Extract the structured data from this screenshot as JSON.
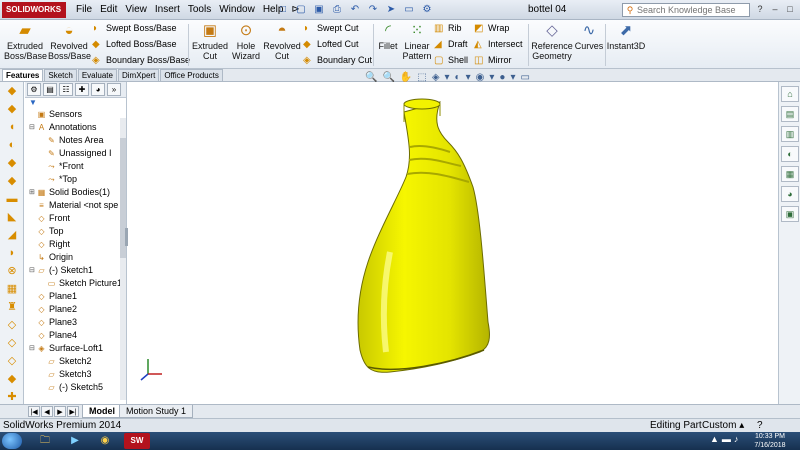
{
  "app": {
    "logo_text": "SOLIDWORKS",
    "doc_title": "bottel 04",
    "menu": [
      "File",
      "Edit",
      "View",
      "Insert",
      "Tools",
      "Window",
      "Help"
    ],
    "menu_pin": "⊳",
    "quick_tools": [
      "□",
      "▢",
      "▣",
      "⎙",
      "↶",
      "↷",
      "➤",
      "▭",
      "⚙"
    ],
    "window_controls": [
      "?",
      "–",
      "□",
      "✕"
    ]
  },
  "search": {
    "placeholder": "Search Knowledge Base"
  },
  "ribbon": {
    "extruded_boss": "Extruded Boss/Base",
    "revolved_boss": "Revolved Boss/Base",
    "swept_boss": "Swept Boss/Base",
    "lofted_boss": "Lofted Boss/Base",
    "boundary_boss": "Boundary Boss/Base",
    "extruded_cut": "Extruded Cut",
    "hole_wizard": "Hole Wizard",
    "revolved_cut": "Revolved Cut",
    "swept_cut": "Swept Cut",
    "lofted_cut": "Lofted Cut",
    "boundary_cut": "Boundary Cut",
    "fillet": "Fillet",
    "linear_pattern": "Linear Pattern",
    "rib": "Rib",
    "draft": "Draft",
    "shell": "Shell",
    "wrap": "Wrap",
    "intersect": "Intersect",
    "mirror": "Mirror",
    "reference_geometry": "Reference Geometry",
    "curves": "Curves",
    "instant3d": "Instant3D"
  },
  "command_tabs": [
    "Features",
    "Sketch",
    "Evaluate",
    "DimXpert",
    "Office Products"
  ],
  "active_command_tab": "Features",
  "hud_icons": [
    "🔍",
    "🔍",
    "✋",
    "⬚",
    "◈",
    "▾",
    "◐",
    "▾",
    "◉",
    "▾",
    "●",
    "▾",
    "▭"
  ],
  "vertical_toolbar_icons": [
    "◆",
    "◆",
    "◖",
    "◐",
    "◆",
    "◆",
    "▬",
    "◣",
    "◢",
    "◗",
    "⊗",
    "▦",
    "♜",
    "◇",
    "◇",
    "◇",
    "◆",
    "✚",
    "♒"
  ],
  "feature_manager": {
    "tab_icons": [
      "⚙",
      "▤",
      "☷",
      "✚",
      "◕",
      "»"
    ],
    "filter_icon": "▼",
    "tree": [
      {
        "label": "Sensors",
        "depth": 0,
        "expander": "",
        "icon": "▣"
      },
      {
        "label": "Annotations",
        "depth": 0,
        "expander": "⊟",
        "icon": "A"
      },
      {
        "label": "Notes Area",
        "depth": 1,
        "expander": "",
        "icon": "✎"
      },
      {
        "label": "Unassigned I",
        "depth": 1,
        "expander": "",
        "icon": "✎"
      },
      {
        "label": "*Front",
        "depth": 1,
        "expander": "",
        "icon": "⤳"
      },
      {
        "label": "*Top",
        "depth": 1,
        "expander": "",
        "icon": "⤳"
      },
      {
        "label": "Solid Bodies(1)",
        "depth": 0,
        "expander": "⊞",
        "icon": "▦"
      },
      {
        "label": "Material <not spe",
        "depth": 0,
        "expander": "",
        "icon": "≡"
      },
      {
        "label": "Front",
        "depth": 0,
        "expander": "",
        "icon": "◇"
      },
      {
        "label": "Top",
        "depth": 0,
        "expander": "",
        "icon": "◇"
      },
      {
        "label": "Right",
        "depth": 0,
        "expander": "",
        "icon": "◇"
      },
      {
        "label": "Origin",
        "depth": 0,
        "expander": "",
        "icon": "↳"
      },
      {
        "label": "(-) Sketch1",
        "depth": 0,
        "expander": "⊟",
        "icon": "▱"
      },
      {
        "label": "Sketch Picture1",
        "depth": 1,
        "expander": "",
        "icon": "▭"
      },
      {
        "label": "Plane1",
        "depth": 0,
        "expander": "",
        "icon": "◇"
      },
      {
        "label": "Plane2",
        "depth": 0,
        "expander": "",
        "icon": "◇"
      },
      {
        "label": "Plane3",
        "depth": 0,
        "expander": "",
        "icon": "◇"
      },
      {
        "label": "Plane4",
        "depth": 0,
        "expander": "",
        "icon": "◇"
      },
      {
        "label": "Surface-Loft1",
        "depth": 0,
        "expander": "⊟",
        "icon": "◈"
      },
      {
        "label": "Sketch2",
        "depth": 1,
        "expander": "",
        "icon": "▱"
      },
      {
        "label": "Sketch3",
        "depth": 1,
        "expander": "",
        "icon": "▱"
      },
      {
        "label": "(-) Sketch5",
        "depth": 1,
        "expander": "",
        "icon": "▱"
      }
    ]
  },
  "task_pane_icons": [
    "⌂",
    "▤",
    "▥",
    "◐",
    "▦",
    "◕",
    "▣"
  ],
  "bottom_tabs": {
    "nav_arrows": [
      "|◀",
      "◀",
      "▶",
      "▶|"
    ],
    "model": "Model",
    "motion_study": "Motion Study 1"
  },
  "status": {
    "app_name": "SolidWorks Premium 2014",
    "mode": "Editing Part",
    "units": "Custom",
    "units_icon": "▴",
    "help_icon": "?"
  },
  "taskbar": {
    "apps": [
      "🗀",
      "▶",
      "◉",
      "SW"
    ],
    "tray_icons": [
      "▲",
      "▬",
      "♪"
    ],
    "time": "10:33 PM",
    "date": "7/16/2018"
  },
  "colors": {
    "part": "#eded00",
    "part_shadow": "#b0b000",
    "accent": "#b3121d"
  }
}
